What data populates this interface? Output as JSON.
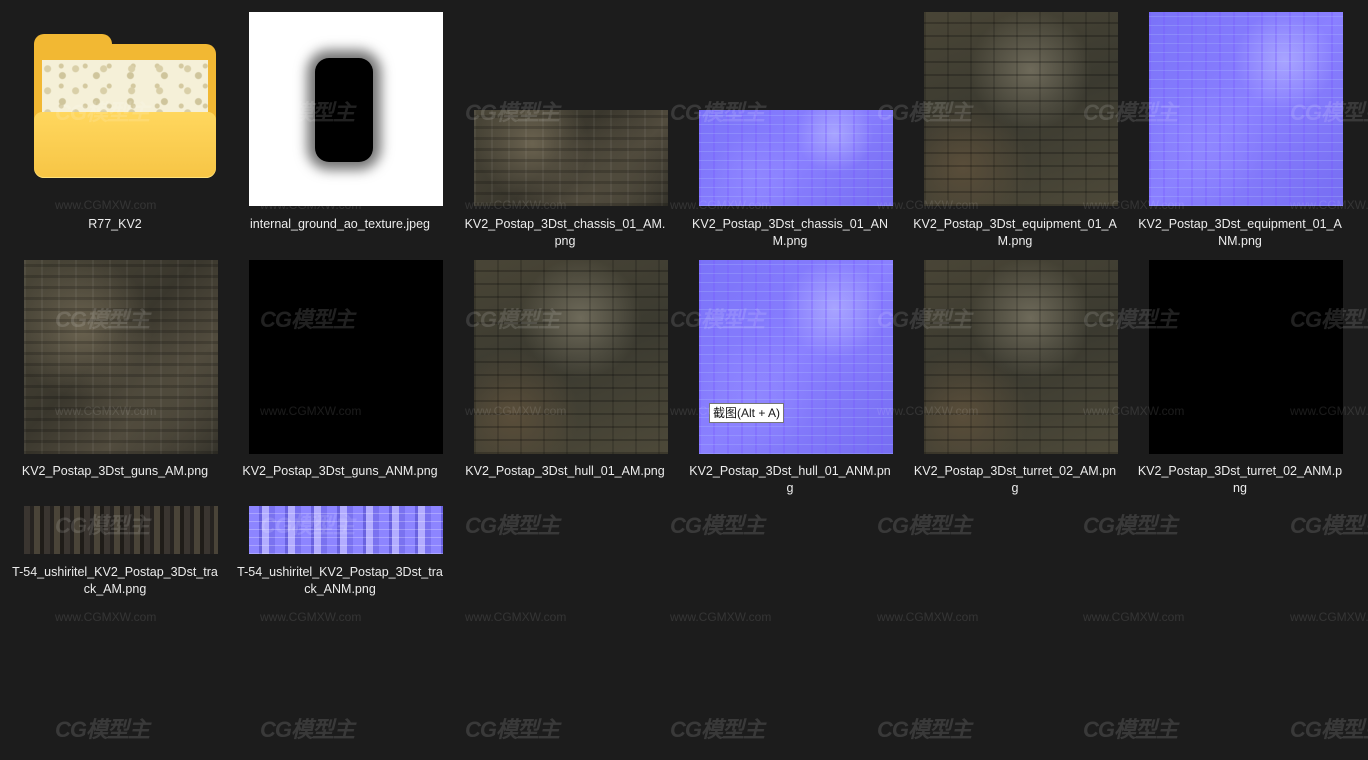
{
  "items": [
    {
      "label": "R77_KV2",
      "kind": "folder"
    },
    {
      "label": "internal_ground_ao_texture.jpeg",
      "kind": "ao"
    },
    {
      "label": "KV2_Postap_3Dst_chassis_01_AM.png",
      "kind": "am"
    },
    {
      "label": "KV2_Postap_3Dst_chassis_01_ANM.png",
      "kind": "anm"
    },
    {
      "label": "KV2_Postap_3Dst_equipment_01_AM.png",
      "kind": "am2"
    },
    {
      "label": "KV2_Postap_3Dst_equipment_01_ANM.png",
      "kind": "anm"
    },
    {
      "label": "KV2_Postap_3Dst_guns_AM.png",
      "kind": "am"
    },
    {
      "label": "KV2_Postap_3Dst_guns_ANM.png",
      "kind": "black"
    },
    {
      "label": "KV2_Postap_3Dst_hull_01_AM.png",
      "kind": "am2"
    },
    {
      "label": "KV2_Postap_3Dst_hull_01_ANM.png",
      "kind": "anm"
    },
    {
      "label": "KV2_Postap_3Dst_turret_02_AM.png",
      "kind": "am2"
    },
    {
      "label": "KV2_Postap_3Dst_turret_02_ANM.png",
      "kind": "black"
    },
    {
      "label": "T-54_ushiritel_KV2_Postap_3Dst_track_AM.png",
      "kind": "track-am"
    },
    {
      "label": "T-54_ushiritel_KV2_Postap_3Dst_track_ANM.png",
      "kind": "track-anm"
    }
  ],
  "tooltip": "截图(Alt + A)",
  "watermark": {
    "logo": "CG模型主",
    "url": "www.CGMXW.com"
  }
}
